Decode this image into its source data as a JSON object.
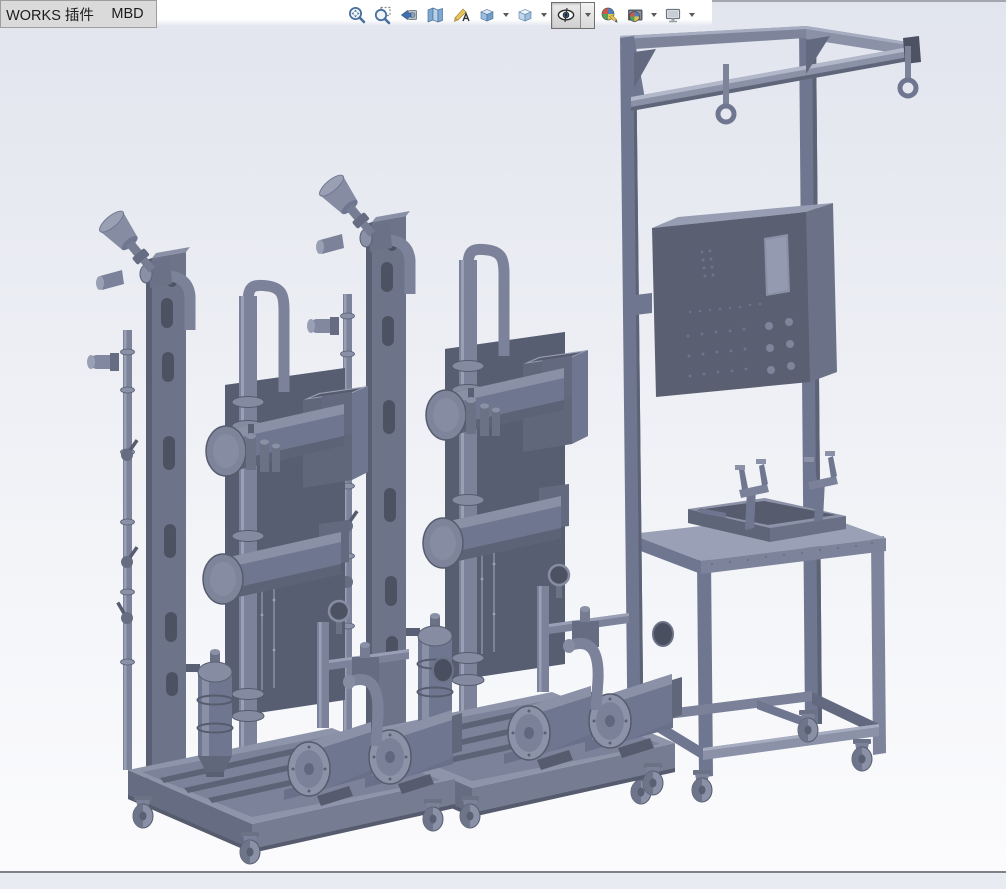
{
  "command_tabs": [
    {
      "label": "WORKS 插件"
    },
    {
      "label": "MBD"
    }
  ],
  "heads_up_toolbar": {
    "items": [
      {
        "name": "zoom-to-fit",
        "icon": "magnifier-fit-icon",
        "has_dropdown": false,
        "pressed": false
      },
      {
        "name": "zoom-to-area",
        "icon": "magnifier-area-icon",
        "has_dropdown": false,
        "pressed": false
      },
      {
        "name": "previous-view",
        "icon": "camera-back-arrow-icon",
        "has_dropdown": false,
        "pressed": false
      },
      {
        "name": "section-view",
        "icon": "section-panels-icon",
        "has_dropdown": false,
        "pressed": false
      },
      {
        "name": "dynamic-annotation-views",
        "icon": "pencil-annotation-icon",
        "has_dropdown": false,
        "pressed": false
      },
      {
        "name": "view-orientation",
        "icon": "orientation-cube-icon",
        "has_dropdown": true,
        "pressed": false
      },
      {
        "name": "display-style",
        "icon": "display-style-cube-icon",
        "has_dropdown": true,
        "pressed": false
      },
      {
        "name": "hide-show-items",
        "icon": "eye-icon",
        "has_dropdown": true,
        "pressed": true
      },
      {
        "name": "edit-appearance",
        "icon": "appearance-ball-pencil-icon",
        "has_dropdown": false,
        "pressed": false
      },
      {
        "name": "apply-scene",
        "icon": "scene-ball-icon",
        "has_dropdown": true,
        "pressed": false
      },
      {
        "name": "view-settings",
        "icon": "monitor-icon",
        "has_dropdown": true,
        "pressed": false
      }
    ]
  },
  "viewport": {
    "background_gradient": {
      "top": "#e2e5ee",
      "middle": "#eef0f5",
      "bottom": "#fbfbfd"
    },
    "floor_line_color": "#7e8188",
    "below_floor_color": "#e9ebf2",
    "model_palette": {
      "darkest": "#4d5263",
      "dark": "#585e71",
      "middark": "#636a7f",
      "mid": "#6f7690",
      "midlight": "#7b829a",
      "light": "#8b92a8",
      "lighter": "#9aa0b5",
      "highlight": "#aeb4c7"
    },
    "model_assemblies": [
      {
        "name": "pump-skid-front",
        "parts": [
          "slotted-column",
          "angled-actuator-valve",
          "left-valve-pipe",
          "flanged-riser-pipe",
          "horizontal-vessel-upper",
          "horizontal-vessel-lower",
          "plate-heat-exchanger-panel",
          "top-cabinet",
          "filter-regulator-unit",
          "pressure-gauge",
          "valve-cluster",
          "filter-housing",
          "pump-motor-1",
          "pump-motor-2",
          "wheeled-base",
          "casters"
        ]
      },
      {
        "name": "pump-skid-rear",
        "parts": [
          "slotted-column",
          "angled-actuator-valve",
          "left-valve-pipe",
          "flanged-riser-pipe",
          "horizontal-vessel-upper",
          "horizontal-vessel-lower",
          "plate-heat-exchanger-panel",
          "top-cabinet",
          "filter-regulator-unit",
          "pressure-gauge",
          "valve-cluster",
          "filter-housing",
          "pump-motor-1",
          "pump-motor-2",
          "wheeled-base",
          "casters"
        ]
      },
      {
        "name": "control-stand",
        "parts": [
          "gantry-frame",
          "left-post",
          "mid-post",
          "eye-hook-left",
          "eye-hook-right",
          "control-panel-enclosure",
          "display-window",
          "button-grid",
          "equipment-table",
          "storage-tray",
          "fork-holder-left",
          "fork-holder-right",
          "bottom-shelf",
          "casters"
        ]
      }
    ]
  }
}
